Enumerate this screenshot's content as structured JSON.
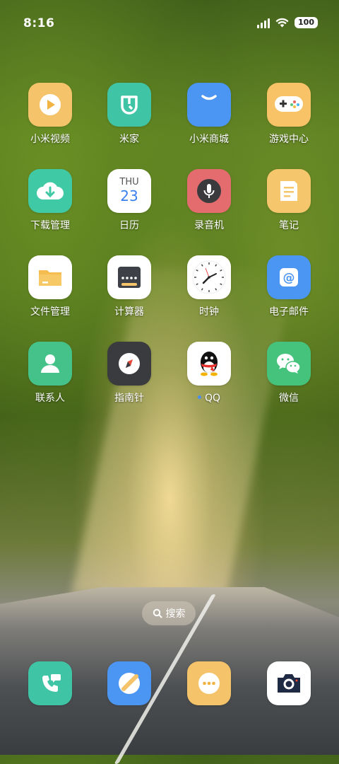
{
  "status_bar": {
    "time": "8:16",
    "battery": "100"
  },
  "apps": [
    {
      "label": "小米视频",
      "icon": "play-video-icon",
      "color": "#f5c46a"
    },
    {
      "label": "米家",
      "icon": "mijia-icon",
      "color": "#3fc5a5"
    },
    {
      "label": "小米商城",
      "icon": "shopping-bag-icon",
      "color": "#4b95f3"
    },
    {
      "label": "游戏中心",
      "icon": "gamepad-icon",
      "color": "#f7c366"
    },
    {
      "label": "下载管理",
      "icon": "download-cloud-icon",
      "color": "#3fc9a5"
    },
    {
      "label": "日历",
      "icon": "calendar-icon",
      "color": "#ffffff",
      "weekday": "THU",
      "day": "23"
    },
    {
      "label": "录音机",
      "icon": "microphone-icon",
      "color": "#e46c6f"
    },
    {
      "label": "笔记",
      "icon": "notes-icon",
      "color": "#f5c66b"
    },
    {
      "label": "文件管理",
      "icon": "folder-icon",
      "color": "#ffffff"
    },
    {
      "label": "计算器",
      "icon": "calculator-icon",
      "color": "#ffffff"
    },
    {
      "label": "时钟",
      "icon": "clock-icon",
      "color": "#ffffff"
    },
    {
      "label": "电子邮件",
      "icon": "email-at-icon",
      "color": "#4b95f3"
    },
    {
      "label": "联系人",
      "icon": "contact-person-icon",
      "color": "#45c28a"
    },
    {
      "label": "指南针",
      "icon": "compass-icon",
      "color": "#3a3b3f"
    },
    {
      "label": "QQ",
      "icon": "qq-penguin-icon",
      "color": "#ffffff"
    },
    {
      "label": "微信",
      "icon": "wechat-icon",
      "color": "#45c37d"
    }
  ],
  "search": {
    "label": "搜索"
  },
  "dock": [
    {
      "name": "phone",
      "icon": "phone-icon",
      "color": "#3fc5a5"
    },
    {
      "name": "browser",
      "icon": "browser-icon",
      "color": "#4b95f3"
    },
    {
      "name": "messages",
      "icon": "message-icon",
      "color": "#f5c46a"
    },
    {
      "name": "camera",
      "icon": "camera-icon",
      "color": "#ffffff"
    }
  ]
}
